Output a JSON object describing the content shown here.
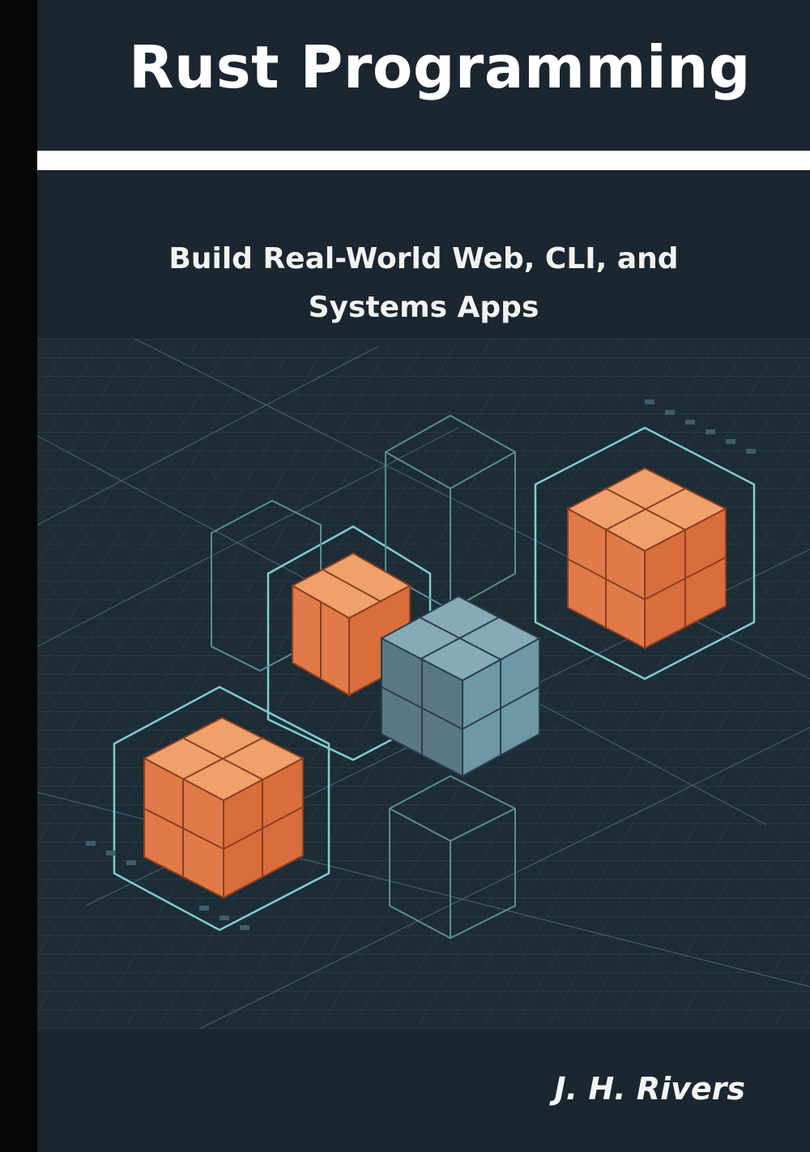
{
  "cover": {
    "title": "Rust Programming",
    "subtitle_line1": "Build Real-World Web, CLI, and",
    "subtitle_line2": "Systems Apps",
    "author": "J. H. Rivers"
  },
  "colors": {
    "background": "#1b2631",
    "spine": "#050607",
    "cube_orange": "#e07a48",
    "cube_blue": "#6e97a8",
    "wireframe": "#7fd0cf",
    "grid": "#3a5a66"
  },
  "illustration": {
    "description_icons": [
      "isometric-cube-icon",
      "wireframe-grid"
    ]
  }
}
